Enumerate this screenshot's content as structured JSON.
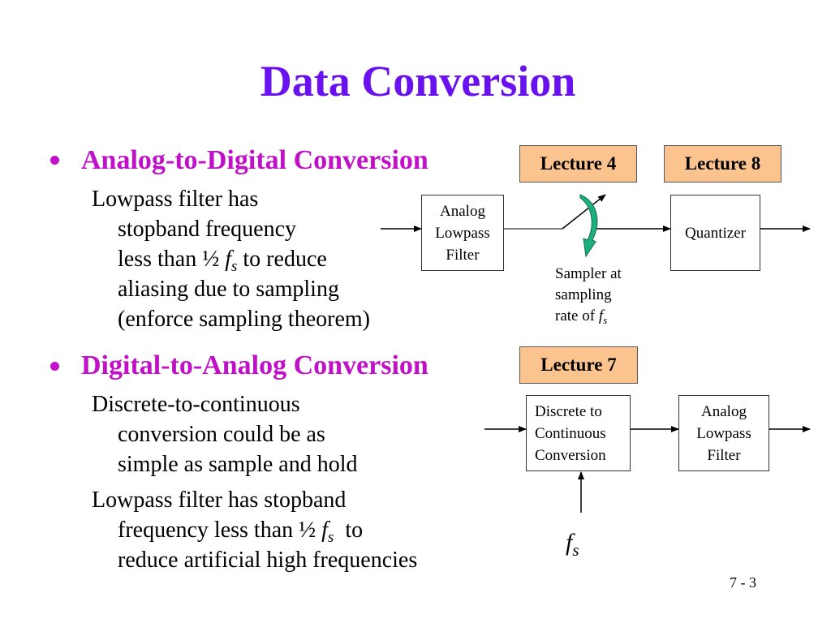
{
  "slide": {
    "title": "Data Conversion",
    "page_number": "7 - 3",
    "colors": {
      "title": "#6a11f0",
      "heading": "#c010c8",
      "lecture_fill": "#fbc38e",
      "sampler_arrow": "#1fb080"
    }
  },
  "adc": {
    "heading": "Analog-to-Digital Conversion",
    "lines": [
      {
        "text": "Lowpass filter has"
      },
      {
        "text": "stopband frequency"
      },
      {
        "pre": "less than ½ ",
        "italic": "f",
        "sub": "s",
        "post": " to reduce"
      },
      {
        "text": "aliasing due to sampling"
      },
      {
        "text": "(enforce sampling theorem)"
      }
    ],
    "lecture_a": "Lecture 4",
    "lecture_b": "Lecture 8",
    "filter_block": [
      "Analog",
      "Lowpass",
      "Filter"
    ],
    "quantizer_block": "Quantizer",
    "sampler_icon": "rotating-switch-icon",
    "sampler_label": {
      "line1": "Sampler at",
      "line2": "sampling",
      "line3_pre": "rate of ",
      "line3_italic": "f",
      "line3_sub": "s"
    }
  },
  "dac": {
    "heading": "Digital-to-Analog Conversion",
    "para1": [
      "Discrete-to-continuous",
      "conversion could be as",
      "simple as sample and hold"
    ],
    "para2": [
      {
        "text": "Lowpass filter has stopband"
      },
      {
        "pre": "frequency less than ½ ",
        "italic": "f",
        "sub": "s",
        "post": "  to"
      },
      {
        "text": "reduce artificial high frequencies"
      }
    ],
    "lecture": "Lecture 7",
    "dc_block": [
      "Discrete to",
      "Continuous",
      "Conversion"
    ],
    "filter_block": [
      "Analog",
      "Lowpass",
      "Filter"
    ],
    "clock_label_italic": "f",
    "clock_label_sub": "s"
  }
}
